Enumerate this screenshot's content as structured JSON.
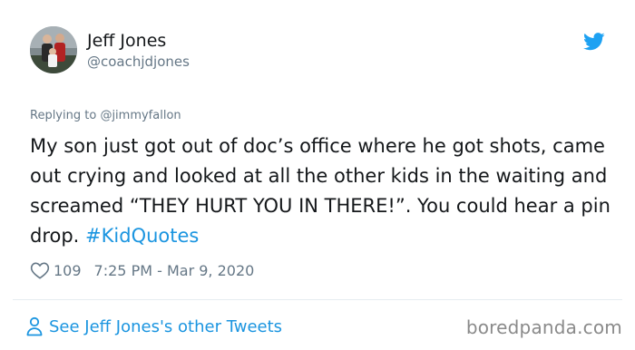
{
  "author": {
    "name": "Jeff Jones",
    "handle": "@coachjdjones"
  },
  "reply": {
    "prefix": "Replying to ",
    "handle": "@jimmyfallon"
  },
  "tweet": {
    "text": "My son just got out of doc’s office where he got shots, came out crying and looked at all the other kids in the waiting and screamed “THEY HURT YOU IN THERE!”. You could hear a pin drop.  ",
    "hashtag": "#KidQuotes"
  },
  "meta": {
    "likes": "109",
    "timestamp": "7:25 PM - Mar 9, 2020"
  },
  "footer": {
    "other_tweets": "See Jeff Jones's other Tweets",
    "watermark": "boredpanda.com"
  },
  "colors": {
    "link": "#1b95e0",
    "muted": "#657786",
    "text": "#14171a",
    "divider": "#e6ecf0"
  },
  "icons": {
    "avatar": "profile-photo",
    "brand": "twitter-bird-icon",
    "like": "heart-outline-icon",
    "profile": "person-outline-icon"
  }
}
